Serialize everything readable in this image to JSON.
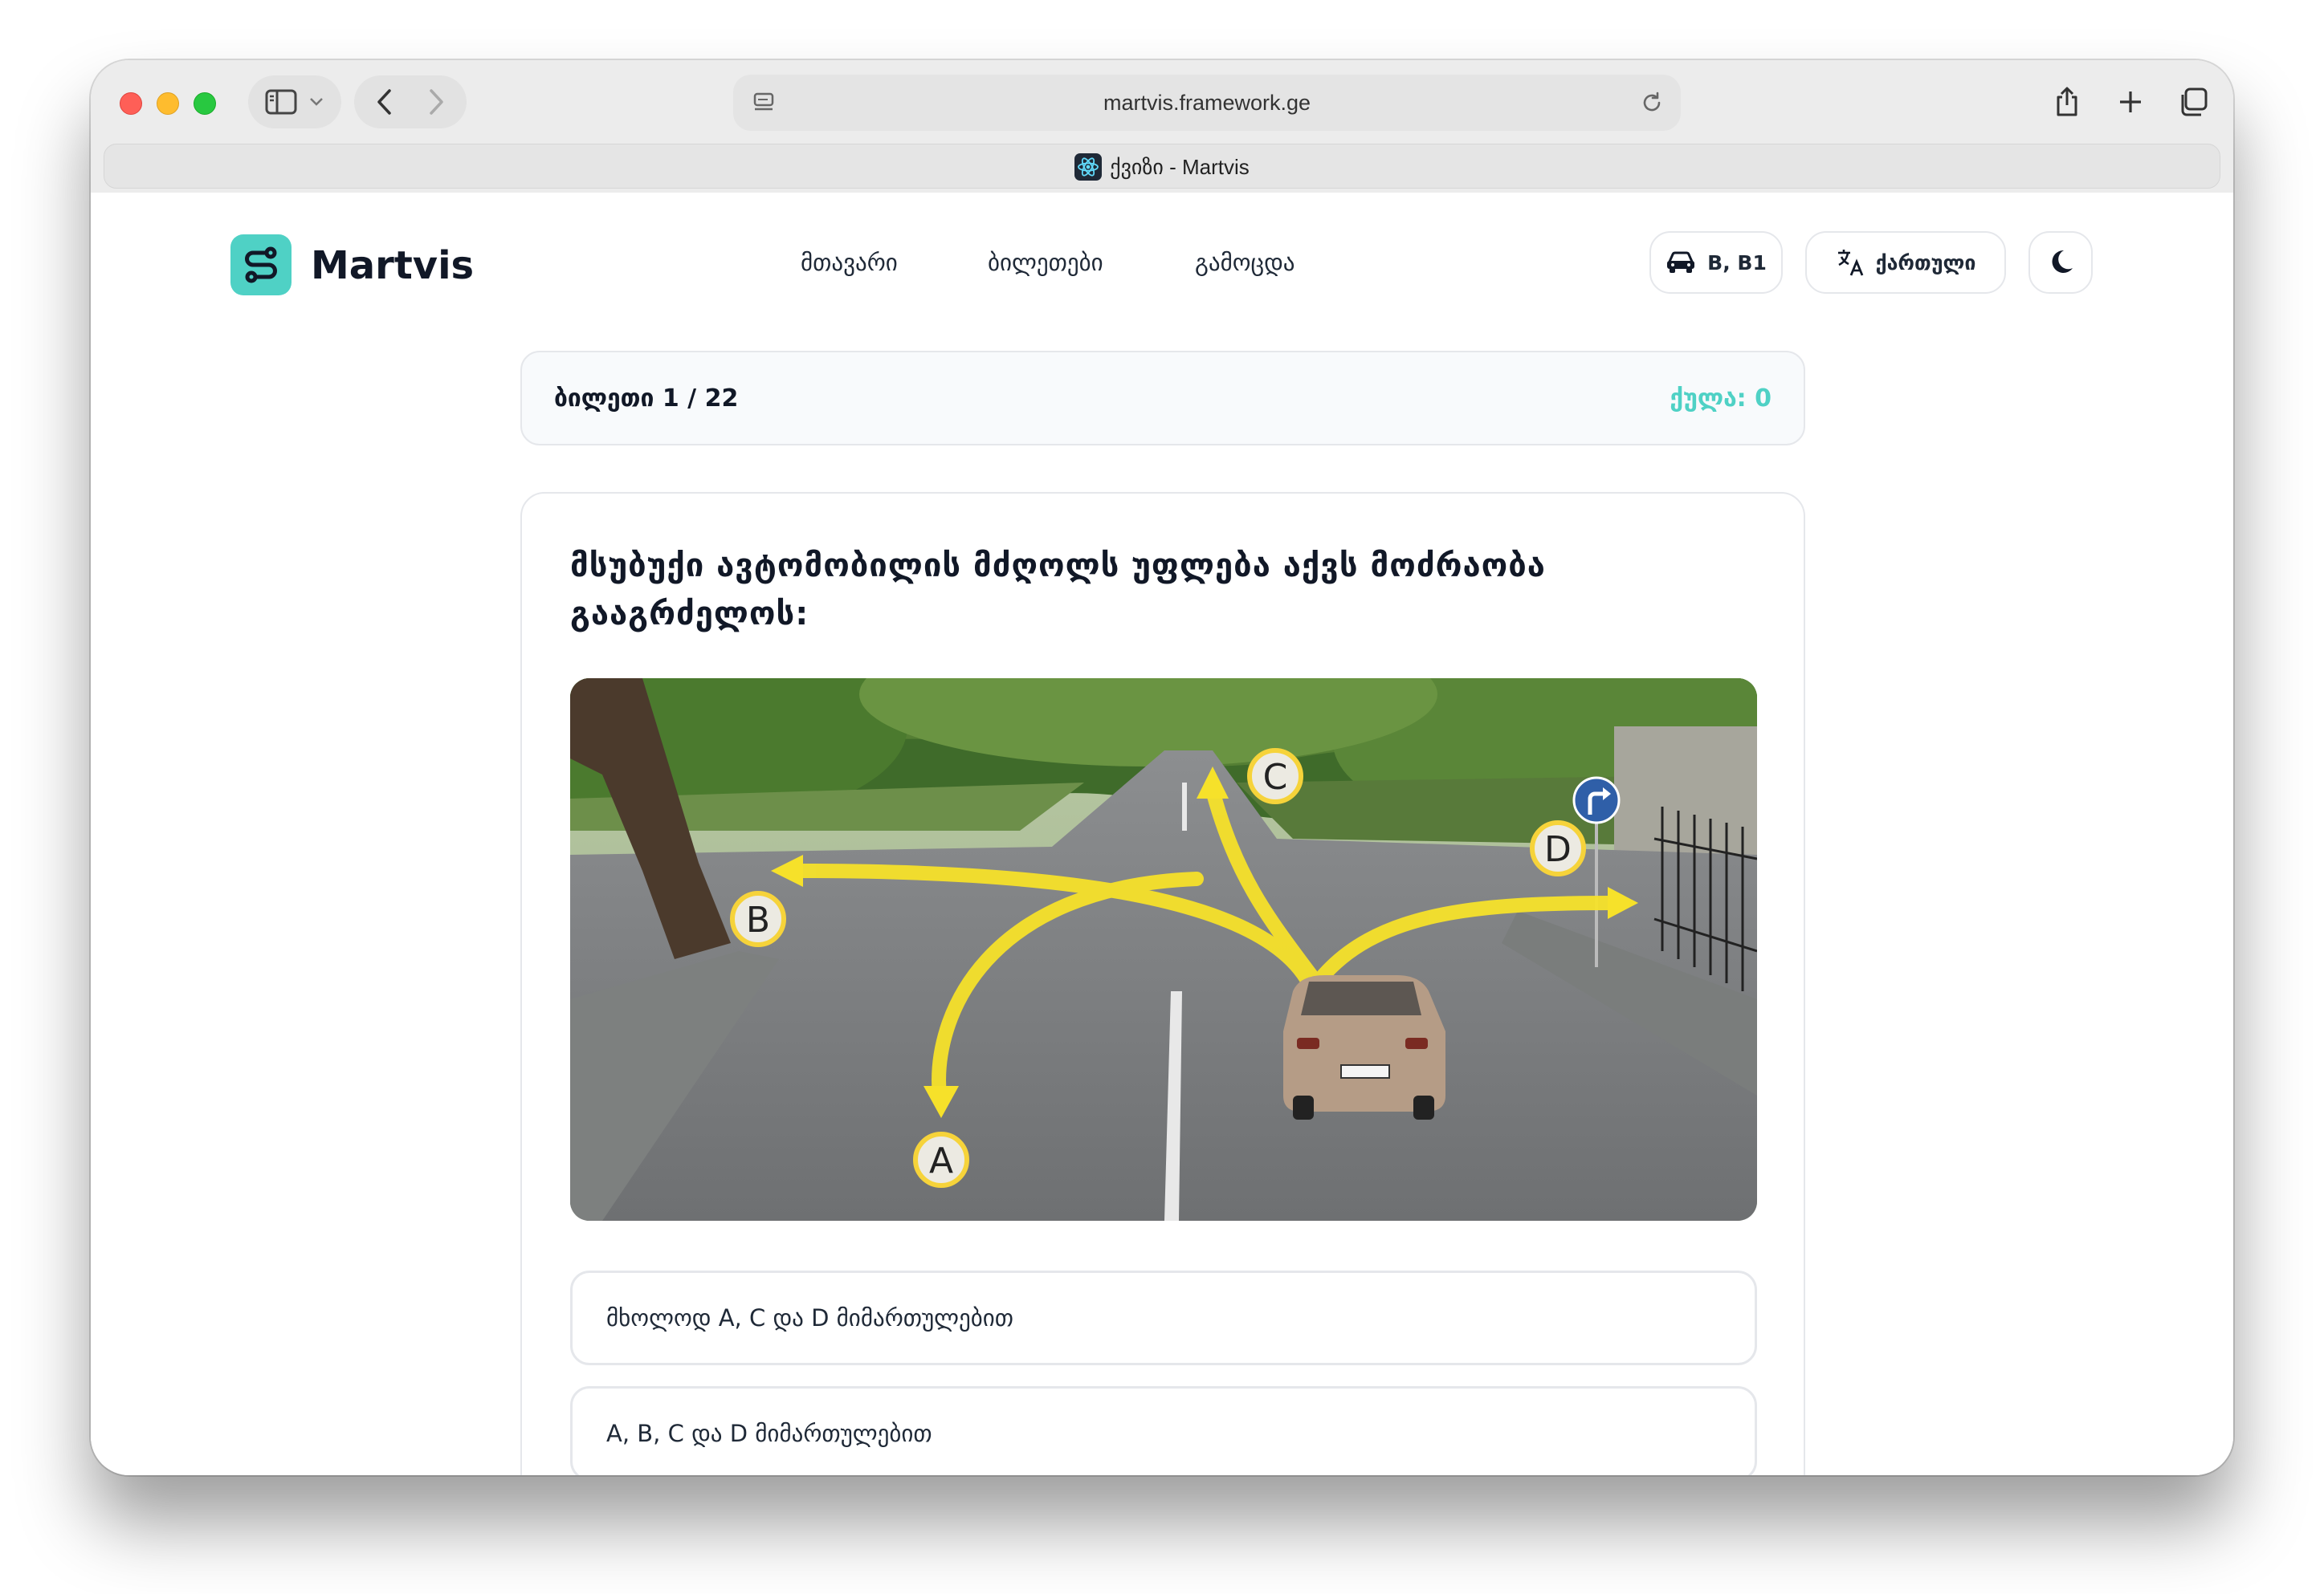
{
  "browser": {
    "url": "martvis.framework.ge",
    "tab_title": "ქვიზი - Martvis"
  },
  "header": {
    "logo_text": "Martvis",
    "nav": [
      "მთავარი",
      "ბილეთები",
      "გამოცდა"
    ],
    "category_label": "B, B1",
    "language_label": "ქართული"
  },
  "quiz": {
    "ticket_label": "ბილეთი 1 / 22",
    "score_label": "ქულა: 0",
    "question": "მსუბუქი ავტომობილის მძღოლს უფლება აქვს მოძრაობა გააგრძელოს:",
    "image_labels": [
      "A",
      "B",
      "C",
      "D"
    ],
    "answers": [
      "მხოლოდ A, C და D მიმართულებით",
      "A, B, C და D მიმართულებით"
    ]
  },
  "colors": {
    "accent": "#4fd1c5",
    "text": "#111827",
    "border": "#e5e7eb"
  }
}
